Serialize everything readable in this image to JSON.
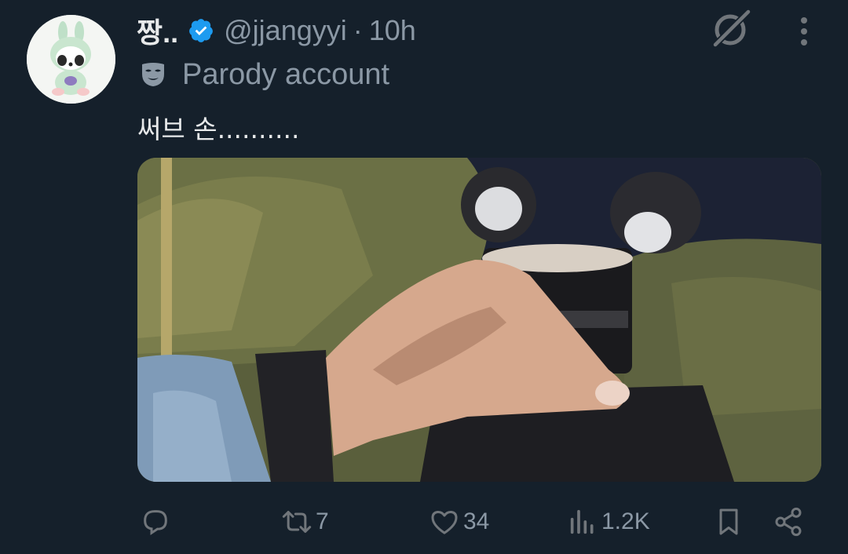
{
  "post": {
    "display_name": "짱..",
    "handle": "@jjangyyi",
    "separator": "·",
    "time": "10h",
    "parody_label": "Parody account",
    "text": "써브 손..........",
    "verified_color": "#1d9bf0"
  },
  "actions": {
    "reply_count": "",
    "repost_count": "7",
    "like_count": "34",
    "views_count": "1.2K"
  },
  "icons": [
    "grok-icon",
    "more-icon",
    "mask-icon",
    "verified-badge-icon",
    "reply-icon",
    "repost-icon",
    "like-icon",
    "views-icon",
    "bookmark-icon",
    "share-icon"
  ],
  "colors": {
    "background": "#15202b",
    "text_primary": "#e7e9ea",
    "text_secondary": "#8b98a5",
    "icon": "#71767b"
  }
}
